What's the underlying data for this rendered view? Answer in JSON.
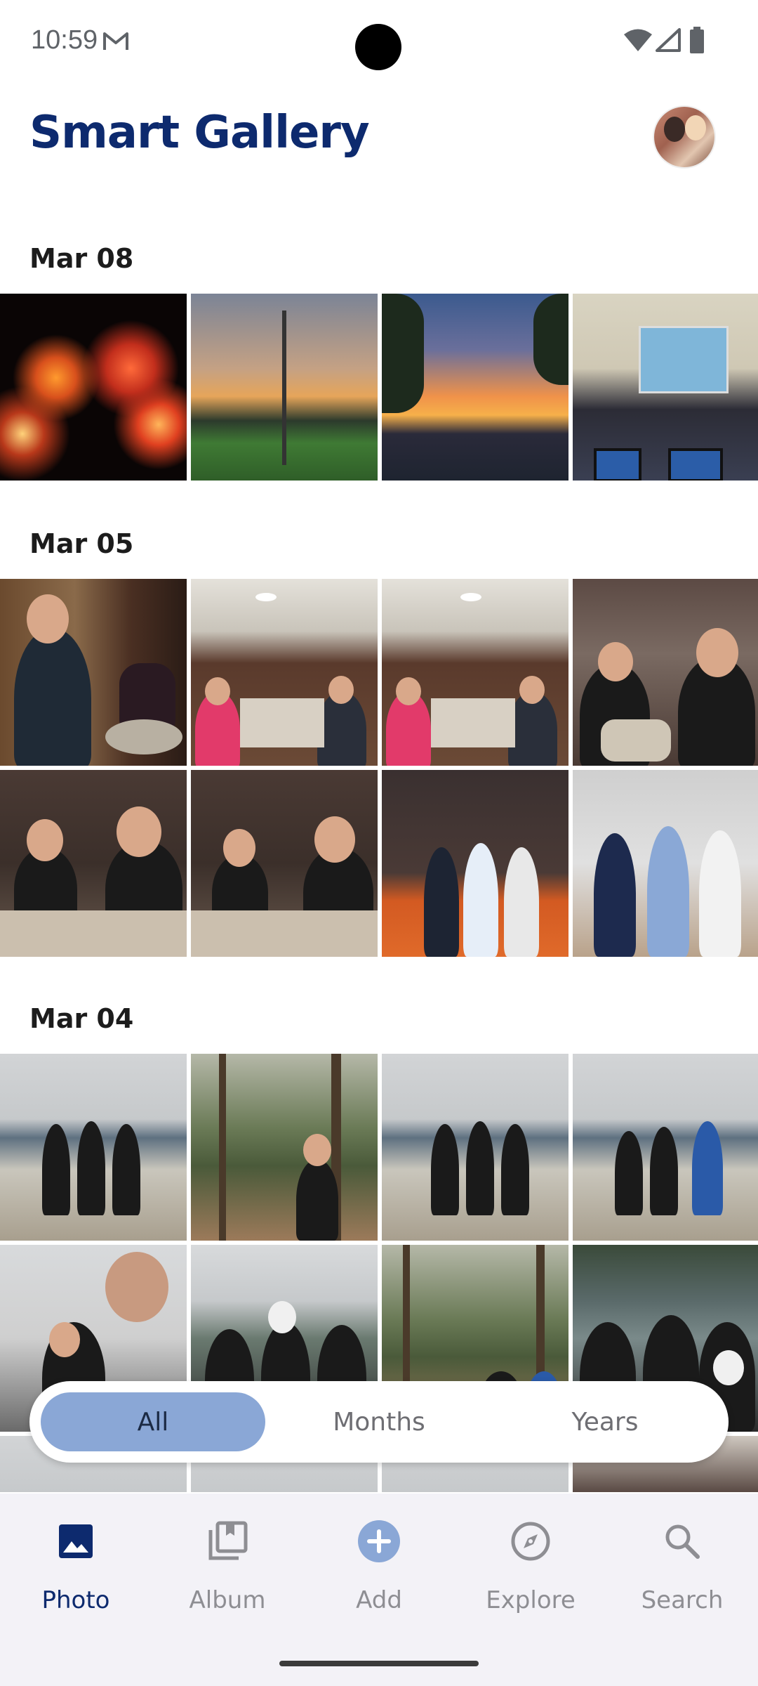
{
  "status_bar": {
    "time": "10:59"
  },
  "header": {
    "title": "Smart Gallery"
  },
  "sections": [
    {
      "date": "Mar 08"
    },
    {
      "date": "Mar 05"
    },
    {
      "date": "Mar 04"
    }
  ],
  "filter": {
    "options": [
      "All",
      "Months",
      "Years"
    ],
    "selected": "All"
  },
  "nav": {
    "items": [
      {
        "label": "Photo",
        "icon": "photo-icon"
      },
      {
        "label": "Album",
        "icon": "album-icon"
      },
      {
        "label": "Add",
        "icon": "add-icon"
      },
      {
        "label": "Explore",
        "icon": "compass-icon"
      },
      {
        "label": "Search",
        "icon": "search-icon"
      }
    ],
    "active": "Photo"
  },
  "colors": {
    "title": "#0d2a6e",
    "accent": "#8aa7d6",
    "nav_bg": "#f3f2f7"
  }
}
